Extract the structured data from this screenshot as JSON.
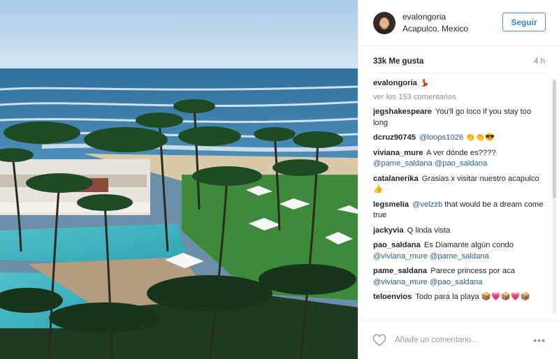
{
  "post": {
    "photo_alt": "beach resort view",
    "author": {
      "username": "evalongoria",
      "location": "Acapulco, Mexico"
    },
    "follow_label": "Seguir",
    "likes": "33k Me gusta",
    "time_ago": "4 h",
    "caption": {
      "username": "evalongoria",
      "text": "💃"
    },
    "view_all": "ver los 153 comentarios",
    "comments": [
      {
        "user": "jegshakespeare",
        "parts": [
          {
            "t": "You'll go loco if you stay too long",
            "m": false
          }
        ]
      },
      {
        "user": "dcruz90745",
        "parts": [
          {
            "t": "@loops1026",
            "m": true
          },
          {
            "t": " 👏👏😎",
            "m": false
          }
        ]
      },
      {
        "user": "viviana_mure",
        "parts": [
          {
            "t": "A ver dónde es???? ",
            "m": false
          },
          {
            "t": "@pame_saldana",
            "m": true
          },
          {
            "t": " ",
            "m": false
          },
          {
            "t": "@pao_saldana",
            "m": true
          }
        ]
      },
      {
        "user": "catalanerika",
        "parts": [
          {
            "t": "Grasias x visitar nuestro acapulco 👍",
            "m": false
          }
        ]
      },
      {
        "user": "legsmelia",
        "parts": [
          {
            "t": "@velzzb",
            "m": true
          },
          {
            "t": " that would be a dream come true",
            "m": false
          }
        ]
      },
      {
        "user": "jackyvia",
        "parts": [
          {
            "t": "Q linda vista",
            "m": false
          }
        ]
      },
      {
        "user": "pao_saldana",
        "parts": [
          {
            "t": "Es Diamante algún condo ",
            "m": false
          },
          {
            "t": "@viviana_mure",
            "m": true
          },
          {
            "t": " ",
            "m": false
          },
          {
            "t": "@pame_saldana",
            "m": true
          }
        ]
      },
      {
        "user": "pame_saldana",
        "parts": [
          {
            "t": "Parece princess por aca ",
            "m": false
          },
          {
            "t": "@viviana_mure",
            "m": true
          },
          {
            "t": " ",
            "m": false
          },
          {
            "t": "@pao_saldana",
            "m": true
          }
        ]
      },
      {
        "user": "teloenvios",
        "parts": [
          {
            "t": "Todo para la playa 📦💗📦💗📦",
            "m": false
          }
        ]
      }
    ],
    "add_comment_placeholder": "Añade un comentario...",
    "more_label": "•••",
    "icons": {
      "like": "heart-outline-icon",
      "options": "more-options-icon"
    },
    "colors": {
      "follow_border": "#4a90d9",
      "follow_text": "#3b82c4",
      "mention": "#2b5d8c",
      "muted": "#8e8e8e"
    }
  }
}
